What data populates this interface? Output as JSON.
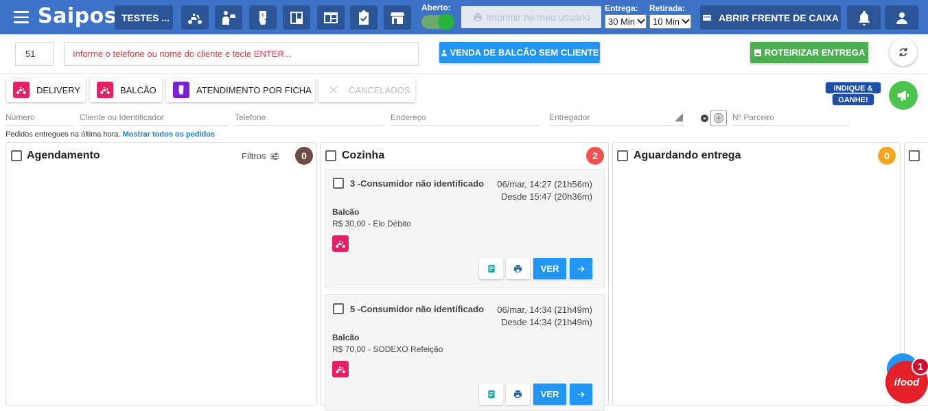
{
  "app": {
    "logo": "Saipos",
    "store_name": "TESTES ..."
  },
  "topbar": {
    "aberto_label": "Aberto:",
    "print_user_label": "Imprimir no meu usuário",
    "entrega_label": "Entrega:",
    "entrega_value": "30 Min",
    "retirada_label": "Retirada:",
    "retirada_value": "10 Min",
    "caixa_label": "ABRIR FRENTE DE CAIXA"
  },
  "search": {
    "number_value": "51",
    "client_placeholder": "Informe o telefone ou nome do cliente e tecle ENTER...",
    "venda_label": "VENDA DE BALCÃO SEM CLIENTE",
    "roteirizar_label": "ROTEIRIZAR ENTREGA"
  },
  "filter_tabs": [
    {
      "label": "DELIVERY",
      "color": "#e91e63"
    },
    {
      "label": "BALCÃO",
      "color": "#e91e63"
    },
    {
      "label": "ATENDIMENTO POR FICHA",
      "color": "#7b1fd6"
    },
    {
      "label": "CANCELADOS"
    }
  ],
  "promo": {
    "line1": "INDIQUE &",
    "line2": "GANHE!"
  },
  "fields": {
    "numero": "Número",
    "cliente": "Cliente ou Identificador",
    "telefone": "Telefone",
    "endereco": "Endereço",
    "entregador": "Entregador",
    "parceiro": "Nº Parceiro"
  },
  "info": {
    "text": "Pedidos entregues na última hora. ",
    "link": "Mostrar todos os pedidos"
  },
  "columns": [
    {
      "title": "Agendamento",
      "count": "0",
      "color": "#6d4c41",
      "filter_label": "Filtros"
    },
    {
      "title": "Cozinha",
      "count": "2",
      "color": "#ef5350"
    },
    {
      "title": "Aguardando entrega",
      "count": "0",
      "color": "#f5a623"
    }
  ],
  "orders": [
    {
      "title": "3 -Consumidor não identificado",
      "date1": "06/mar, 14:27 (21h56m)",
      "date2": "Desde 15:47 (20h36m)",
      "type": "Balcão",
      "payment": "R$ 30,00 - Elo Débito",
      "ver_label": "VER"
    },
    {
      "title": "5 -Consumidor não identificado",
      "date1": "06/mar, 14:34 (21h49m)",
      "date2": "Desde 14:34 (21h49m)",
      "type": "Balcão",
      "payment": "R$ 70,00 - SODEXO Refeição",
      "ver_label": "VER"
    }
  ],
  "ifood": {
    "label": "ifood",
    "badge": "1"
  }
}
